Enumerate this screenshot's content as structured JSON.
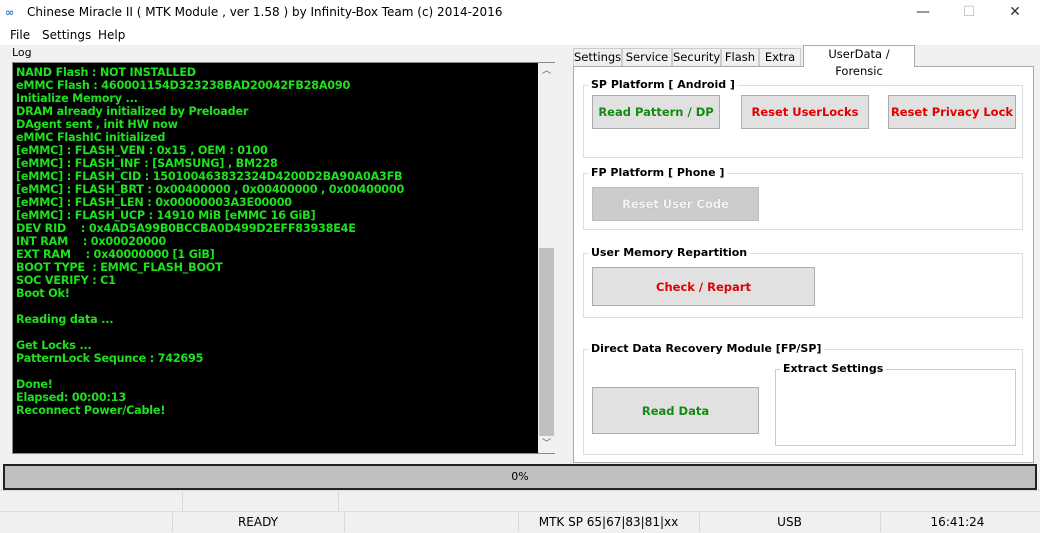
{
  "window": {
    "title": "Chinese Miracle II ( MTK Module , ver 1.58 ) by Infinity-Box Team (c) 2014-2016",
    "icon": "infinity-icon"
  },
  "menu": [
    "File",
    "Settings",
    "Help"
  ],
  "log": {
    "label": "Log",
    "lines": [
      "NAND Flash : NOT INSTALLED",
      "eMMC Flash : 460001154D323238BAD20042FB28A090",
      "Initialize Memory ...",
      "DRAM already initialized by Preloader",
      "DAgent sent , init HW now",
      "eMMC FlashIC initialized",
      "[eMMC] : FLASH_VEN : 0x15 , OEM : 0100",
      "[eMMC] : FLASH_INF : [SAMSUNG] , BM228",
      "[eMMC] : FLASH_CID : 150100463832324D4200D2BA90A0A3FB",
      "[eMMC] : FLASH_BRT : 0x00400000 , 0x00400000 , 0x00400000",
      "[eMMC] : FLASH_LEN : 0x00000003A3E00000",
      "[eMMC] : FLASH_UCP : 14910 MiB [eMMC 16 GiB]",
      "DEV RID    : 0x4AD5A99B0BCCBA0D499D2EFF83938E4E",
      "INT RAM    : 0x00020000",
      "EXT RAM    : 0x40000000 [1 GiB]",
      "BOOT TYPE  : EMMC_FLASH_BOOT",
      "SOC VERIFY : C1",
      "Boot Ok!",
      "",
      "Reading data ...",
      "",
      "Get Locks ...",
      "PatternLock Sequnce : 742695",
      "",
      "Done!",
      "Elapsed: 00:00:13",
      "Reconnect Power/Cable!"
    ]
  },
  "tabs": [
    "Settings",
    "Service",
    "Security",
    "Flash",
    "Extra",
    "UserData / Forensic"
  ],
  "active_tab": "UserData / Forensic",
  "sp": {
    "title": "SP Platform [ Android ]",
    "read_pattern": "Read Pattern / DP",
    "reset_userlocks": "Reset UserLocks",
    "reset_privacy": "Reset Privacy Lock"
  },
  "fp": {
    "title": "FP Platform [ Phone ]",
    "reset_user_code": "Reset User Code"
  },
  "umr": {
    "title": "User Memory Repartition",
    "check": "Check / Repart"
  },
  "ddr": {
    "title": "Direct Data Recovery Module  [FP/SP]",
    "read_data": "Read Data",
    "extract_title": "Extract Settings"
  },
  "progress": {
    "text": "0%",
    "value": 0
  },
  "status": {
    "state": "READY",
    "platform": "MTK SP 65|67|83|81|xx",
    "port": "USB",
    "time": "16:41:24"
  }
}
